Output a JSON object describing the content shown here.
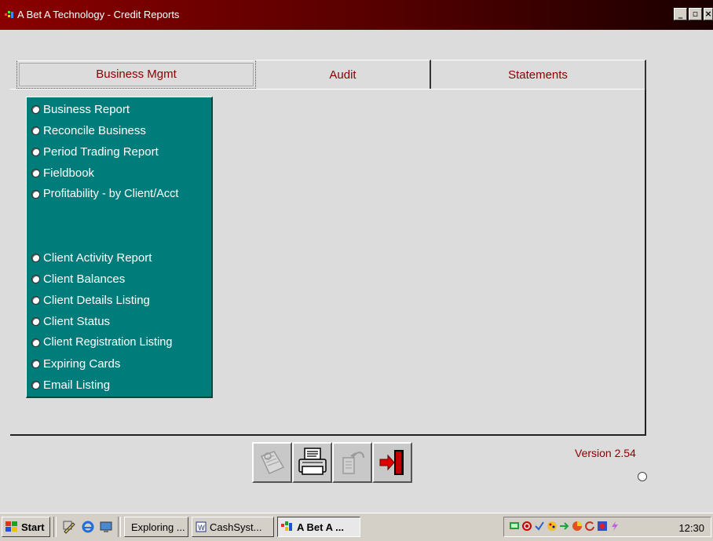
{
  "window": {
    "title": "A Bet A Technology  -  Credit Reports"
  },
  "tabs": [
    {
      "label": "Business Mgmt",
      "active": true
    },
    {
      "label": "Audit"
    },
    {
      "label": "Statements"
    }
  ],
  "options_group1": [
    "Business Report",
    "Reconcile Business",
    "Period Trading Report",
    "Fieldbook",
    "Profitability - by Client/Acct"
  ],
  "options_group2": [
    "Client Activity Report",
    "Client Balances",
    "Client Details Listing",
    "Client Status",
    "Client Registration Listing",
    "Expiring Cards",
    "Email Listing"
  ],
  "toolbar": {
    "icons": [
      "preview-icon",
      "printer-icon",
      "report-tools-icon",
      "exit-door-icon"
    ]
  },
  "version": "Version 2.54",
  "taskbar": {
    "start_label": "Start",
    "tasks": [
      "Exploring ...",
      "CashSyst...",
      "A Bet A ..."
    ],
    "clock": "12:30"
  },
  "colors": {
    "panel": "#007d7b",
    "accent_text": "#8b0000",
    "titlebar": "#8a0000"
  }
}
